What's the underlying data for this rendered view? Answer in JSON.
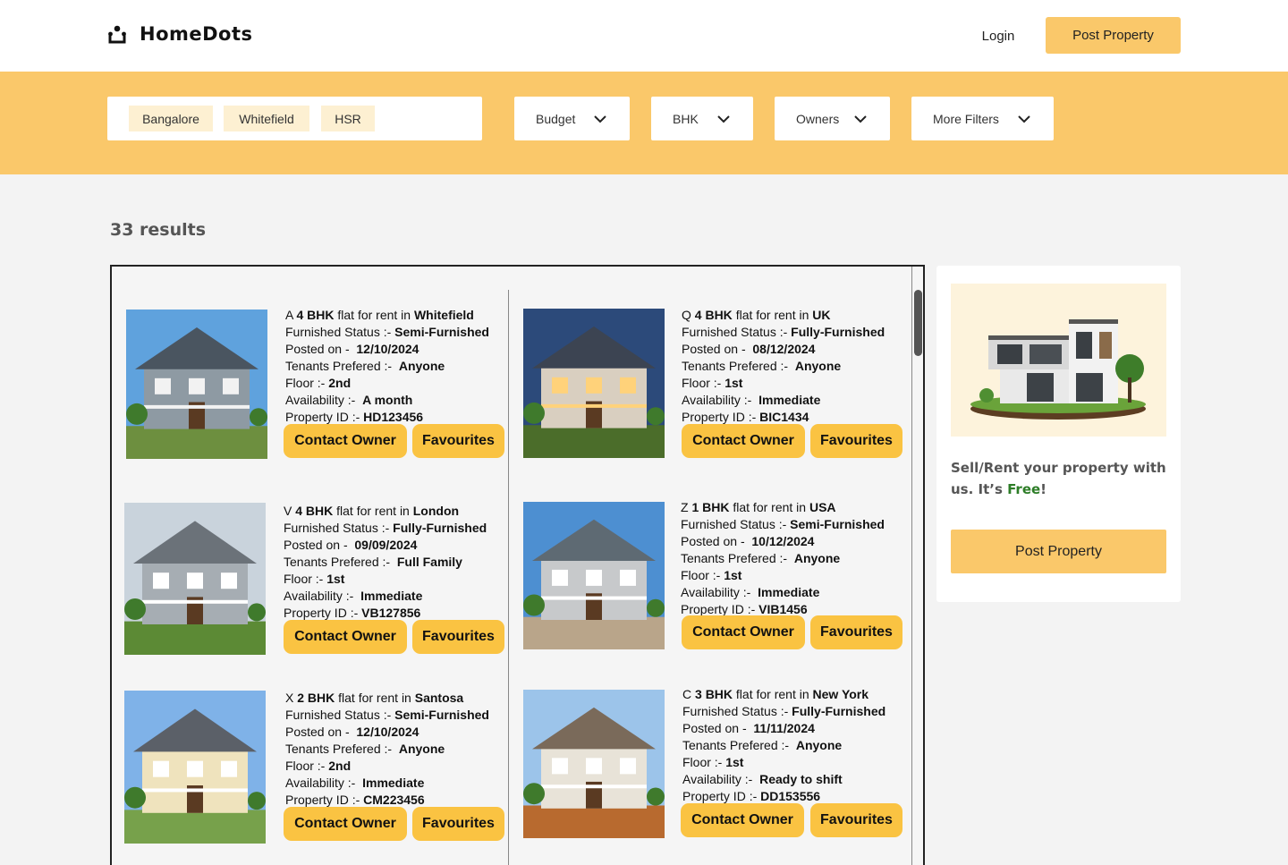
{
  "brand": {
    "name": "HomeDots",
    "accent": "#fac86a",
    "button_color": "#fac342"
  },
  "header": {
    "login_label": "Login",
    "post_property_label": "Post Property"
  },
  "filters": {
    "locations": [
      "Bangalore",
      "Whitefield",
      "HSR"
    ],
    "dropdowns": [
      "Budget",
      "BHK",
      "Owners",
      "More Filters"
    ]
  },
  "results_label": "33 results",
  "labels": {
    "flat_for_rent_in": "flat for rent in",
    "furnished": "Furnished Status :-",
    "posted": "Posted on -",
    "tenants": "Tenants Prefered :-",
    "floor": "Floor :-",
    "availability": "Availability :-",
    "property_id": "Property ID :-",
    "contact": "Contact Owner",
    "favourites": "Favourites"
  },
  "listings": [
    {
      "letter": "A",
      "bhk": "4 BHK",
      "location": "Whitefield",
      "furnished": "Semi-Furnished",
      "posted": "12/10/2024",
      "tenants": "Anyone",
      "floor": "2nd",
      "availability": "A month",
      "property_id": "HD123456",
      "image": "grey-two-storey-house-icon"
    },
    {
      "letter": "Q",
      "bhk": "4 BHK",
      "location": "UK",
      "furnished": "Fully-Furnished",
      "posted": "08/12/2024",
      "tenants": "Anyone",
      "floor": "1st",
      "availability": "Immediate",
      "property_id": "BIC1434",
      "image": "lit-house-at-dusk-icon"
    },
    {
      "letter": "V",
      "bhk": "4 BHK",
      "location": "London",
      "furnished": "Fully-Furnished",
      "posted": "09/09/2024",
      "tenants": "Full Family",
      "floor": "1st",
      "availability": "Immediate",
      "property_id": "VB127856",
      "image": "grey-shingle-house-icon"
    },
    {
      "letter": "Z",
      "bhk": "1 BHK",
      "location": "USA",
      "furnished": "Semi-Furnished",
      "posted": "10/12/2024",
      "tenants": "Anyone",
      "floor": "1st",
      "availability": "Immediate",
      "property_id": "VIB1456",
      "image": "house-with-porch-icon"
    },
    {
      "letter": "X",
      "bhk": "2 BHK",
      "location": "Santosa",
      "furnished": "Semi-Furnished",
      "posted": "12/10/2024",
      "tenants": "Anyone",
      "floor": "2nd",
      "availability": "Immediate",
      "property_id": "CM223456",
      "image": "cream-townhouse-icon"
    },
    {
      "letter": "C",
      "bhk": "3 BHK",
      "location": "New York",
      "furnished": "Fully-Furnished",
      "posted": "11/11/2024",
      "tenants": "Anyone",
      "floor": "1st",
      "availability": "Ready to shift",
      "property_id": "DD153556",
      "image": "autumn-bungalow-icon"
    }
  ],
  "promo": {
    "text_before": "Sell/Rent your property with us. It’s ",
    "text_free": "Free",
    "text_after": "!",
    "button_label": "Post Property"
  }
}
